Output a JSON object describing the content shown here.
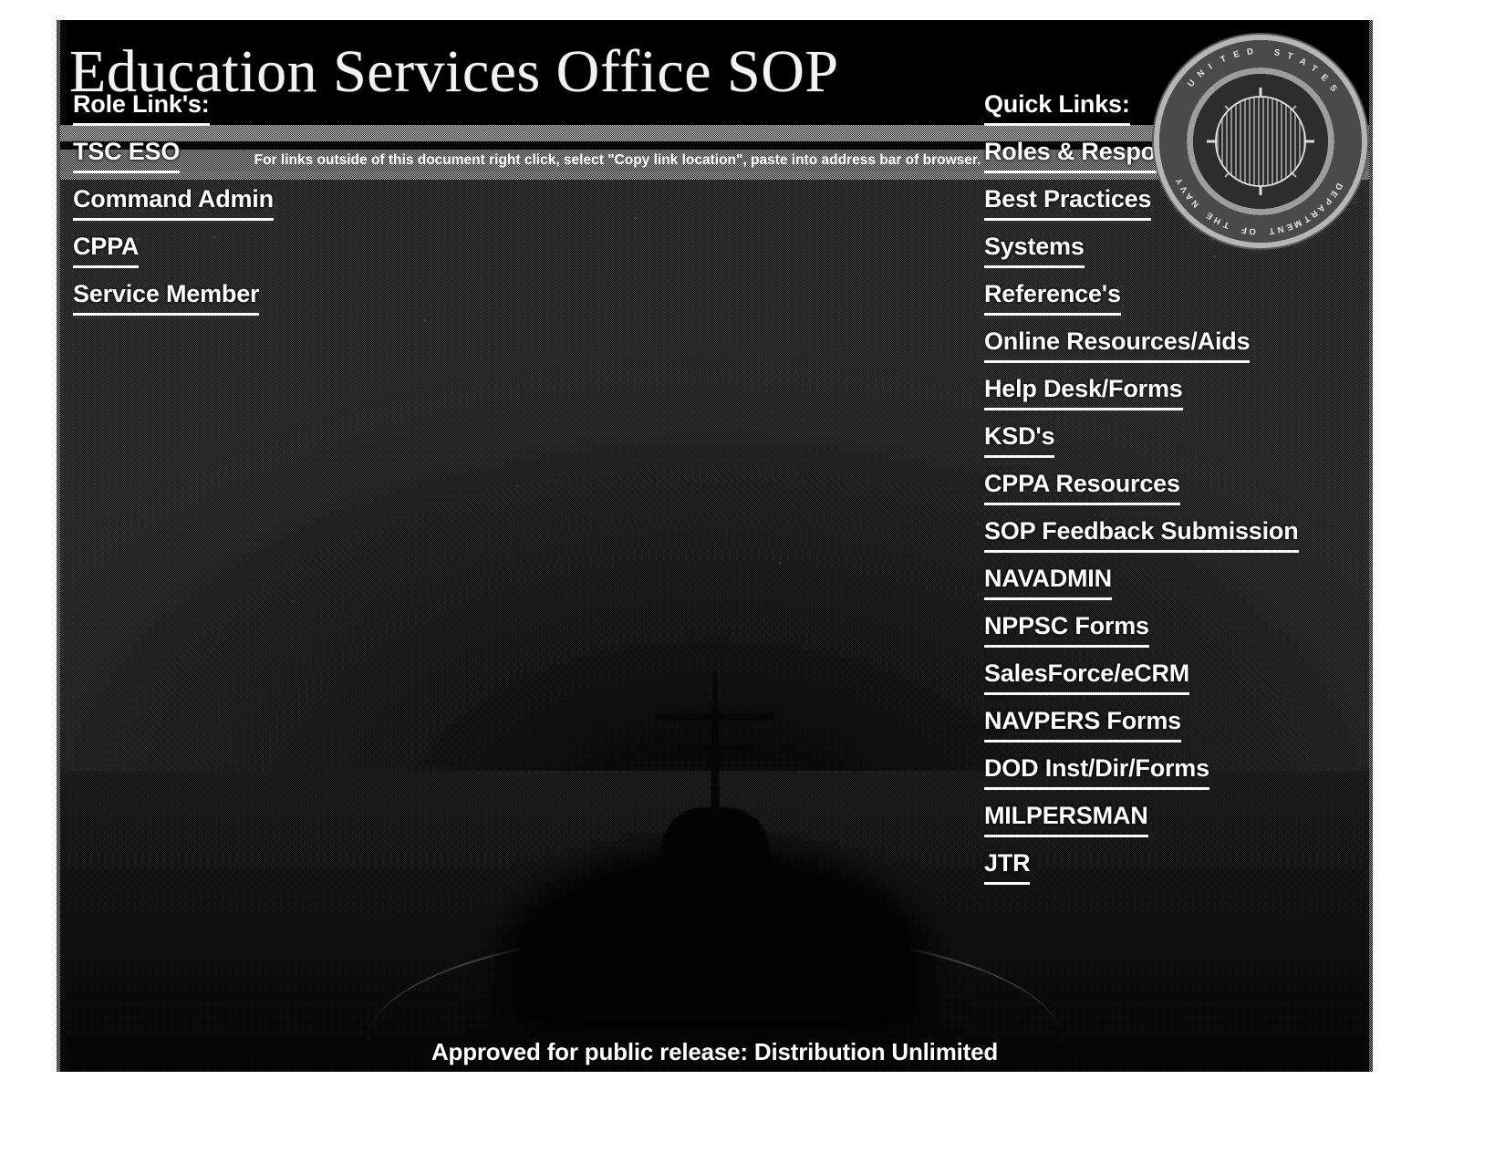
{
  "document": {
    "title": "Education Services Office SOP",
    "instruction": "For links outside of this document right click, select \"Copy link location\", paste into address bar of browser.",
    "footer": "Approved for public release: Distribution Unlimited",
    "background_color": "#000000",
    "text_color": "#ffffff"
  },
  "seal": {
    "name": "navy-seal-emblem",
    "ring_top": "UNITED STATES",
    "ring_bottom": "DEPARTMENT OF THE NAVY"
  },
  "role_links": {
    "heading": "Role Link's:",
    "items": [
      {
        "label": "TSC ESO"
      },
      {
        "label": "Command Admin"
      },
      {
        "label": "CPPA"
      },
      {
        "label": "Service Member"
      }
    ]
  },
  "quick_links": {
    "heading": "Quick Links:",
    "items": [
      {
        "label": "Roles & Responsibilities"
      },
      {
        "label": "Best Practices"
      },
      {
        "label": "Systems"
      },
      {
        "label": "Reference's"
      },
      {
        "label": "Online Resources/Aids"
      },
      {
        "label": "Help Desk/Forms"
      },
      {
        "label": "KSD's"
      },
      {
        "label": "CPPA Resources"
      },
      {
        "label": "SOP Feedback Submission"
      },
      {
        "label": "NAVADMIN"
      },
      {
        "label": "NPPSC Forms"
      },
      {
        "label": "SalesForce/eCRM"
      },
      {
        "label": "NAVPERS Forms"
      },
      {
        "label": "DOD Inst/Dir/Forms"
      },
      {
        "label": "MILPERSMAN"
      },
      {
        "label": "JTR"
      }
    ]
  }
}
